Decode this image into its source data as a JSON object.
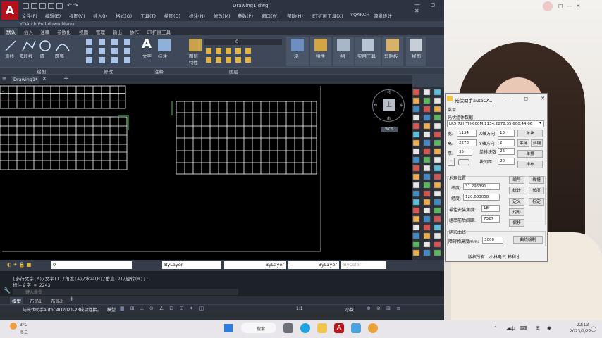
{
  "cad": {
    "logo": "A",
    "title": "Drawing1.dwg",
    "window_controls": "— ◻ ✕",
    "menu": [
      "文件(F)",
      "编辑(E)",
      "视图(V)",
      "插入(I)",
      "格式(O)",
      "工具(T)",
      "绘图(D)",
      "标注(N)",
      "修改(M)",
      "参数(P)",
      "窗口(W)",
      "帮助(H)",
      "ET扩展工具(X)",
      "YQARCH",
      "源泉设计"
    ],
    "pulldown": "YQArch Pull-down Menu",
    "ribbon_tabs": [
      "默认",
      "插入",
      "注释",
      "参数化",
      "视图",
      "管理",
      "输出",
      "协作",
      "ET扩展工具"
    ],
    "draw_tools": [
      "直线",
      "多段线",
      "圆",
      "圆弧"
    ],
    "text_tools": [
      "文字",
      "标注"
    ],
    "layer_tools": [
      "图层",
      "特性"
    ],
    "layer_value": "0",
    "panel_tools": [
      "块",
      "特性",
      "组",
      "实用工具",
      "剪贴板",
      "视图"
    ],
    "panels": [
      "绘图",
      "修改",
      "注释",
      "图层"
    ],
    "doc_tab": "Drawing1*",
    "viewcube": {
      "center": "上",
      "n": "北",
      "s": "南",
      "w": "西",
      "e": "东",
      "wcs": "WCS"
    },
    "props": {
      "layer": "0",
      "color": "ByLayer",
      "linetype": "ByLayer",
      "lineweight": "ByLayer",
      "plotstyle": "ByColor"
    },
    "command": {
      "line1": "[多行文字(M)/文字(T)/角度(A)/水平(H)/垂直(V)/旋转(R)]:",
      "line2": "标注文字 = 2243",
      "prompt": "键入命令"
    },
    "layout_tabs": [
      "模型",
      "布局1",
      "布局2"
    ],
    "status": {
      "msg": "与光伏助手autoCAD2021-23成功连接。",
      "model": "模型",
      "scale": "1:1",
      "units": "小数"
    }
  },
  "dialog": {
    "title": "光伏助手autoCA...",
    "menu": "菜单",
    "module_group": "光伏组件数据",
    "module_select": "LR5-72HTH-600M,1134,2278,35,600,44.66",
    "fields": {
      "width_label": "宽:",
      "width": "1134",
      "height_label": "高:",
      "height": "2278",
      "thick_label": "厚:",
      "thick": "35",
      "xdir_label": "X轴方向",
      "xdir": "13",
      "ydir_label": "Y轴方向",
      "ydir": "2",
      "row_label": "单排块数",
      "row": "26",
      "gap_label": "块间距",
      "gap": "20"
    },
    "buttons": {
      "single": "单块",
      "flat": "平铺",
      "slope": "斜铺",
      "single_row": "单排",
      "layout": "排布"
    },
    "geo_group": "地理位置",
    "geo": {
      "lat_label": "纬度:",
      "lat": "31.296391",
      "lon_label": "经度:",
      "lon": "120.603058",
      "best_label": "最佳安装角度:",
      "best": "18",
      "spacing_label": "组串前后间距:",
      "spacing": "7327"
    },
    "geo_buttons": [
      "编号",
      "线槽",
      "统计",
      "长度",
      "定义",
      "标定",
      "矩形",
      "偏移"
    ],
    "shadow_group": "阴影曲线",
    "shadow_label": "障碍物高度mm:",
    "shadow_value": "3000",
    "shadow_button": "曲线绘制",
    "footer": "版权所有：小林电气 韩利才"
  },
  "taskbar": {
    "weather": "3°C",
    "weather_sub": "多云",
    "search": "搜索",
    "time": "22:13",
    "date": "2023/2/22",
    "lang": "中"
  }
}
